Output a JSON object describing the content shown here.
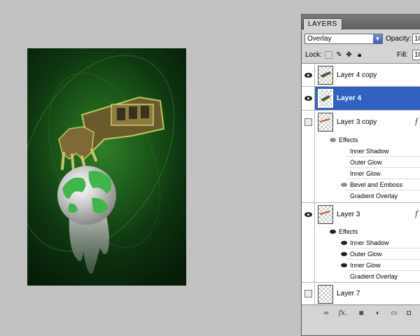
{
  "canvas": {
    "description_colors": {
      "bg_center": "#2f7f2a",
      "bg_edge": "#061d08"
    }
  },
  "panel": {
    "tab_title": "LAYERS",
    "blend_mode": "Overlay",
    "opacity_label": "Opacity:",
    "opacity_value": "10",
    "lock_label": "Lock:",
    "fill_label": "Fill:",
    "fill_value": "10"
  },
  "layers": [
    {
      "name": "Layer 4 copy",
      "visible": true,
      "selected": false
    },
    {
      "name": "Layer 4",
      "visible": true,
      "selected": true
    },
    {
      "name": "Layer 3 copy",
      "visible": false,
      "selected": false,
      "fx": "f",
      "effects_label": "Effects",
      "effects": [
        {
          "name": "Inner Shadow",
          "visible": false
        },
        {
          "name": "Outer Glow",
          "visible": false
        },
        {
          "name": "Inner Glow",
          "visible": false
        },
        {
          "name": "Bevel and Emboss",
          "visible": true
        },
        {
          "name": "Gradient Overlay",
          "visible": false
        }
      ]
    },
    {
      "name": "Layer 3",
      "visible": true,
      "selected": false,
      "fx": "f",
      "effects_label": "Effects",
      "effects": [
        {
          "name": "Inner Shadow",
          "visible": true
        },
        {
          "name": "Outer Glow",
          "visible": true
        },
        {
          "name": "Inner Glow",
          "visible": true
        },
        {
          "name": "Gradient Overlay",
          "visible": false
        }
      ]
    },
    {
      "name": "Layer 7",
      "visible": false,
      "selected": false
    }
  ],
  "footer_icons": [
    "link-icon",
    "fx-icon",
    "mask-icon",
    "adjustment-icon",
    "folder-icon",
    "new-layer-icon"
  ],
  "footer_fx": "fx."
}
